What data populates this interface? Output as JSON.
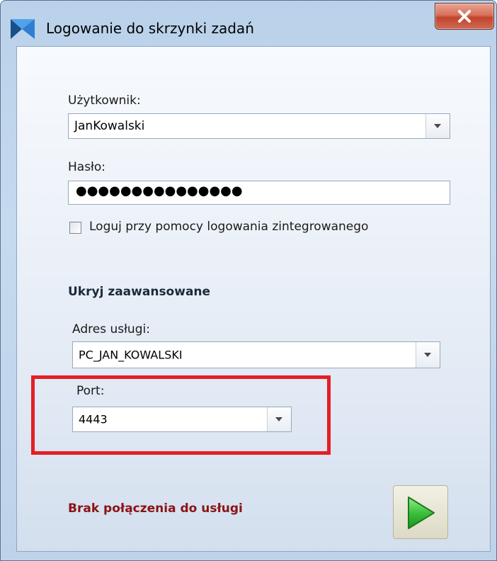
{
  "window": {
    "title": "Logowanie do skrzynki zadań",
    "close_symbol": "X"
  },
  "form": {
    "user_label": "Użytkownik:",
    "user_value": "JanKowalski",
    "password_label": "Hasło:",
    "password_value": "●●●●●●●●●●●●●●●",
    "integrated_login_label": "Loguj przy pomocy logowania zintegrowanego",
    "integrated_login_checked": false,
    "advanced_toggle": "Ukryj zaawansowane",
    "service_address_label": "Adres usługi:",
    "service_address_value": "PC_JAN_KOWALSKI",
    "port_label": "Port:",
    "port_value": "4443"
  },
  "status": {
    "message": "Brak połączenia do usługi",
    "color": "#8b1414"
  },
  "icons": {
    "app": "app-logo-icon",
    "close": "close-icon",
    "dropdown": "chevron-down-icon",
    "login": "play-arrow-icon"
  },
  "colors": {
    "highlight": "#e51e25",
    "go_arrow": "#3cc23a"
  }
}
